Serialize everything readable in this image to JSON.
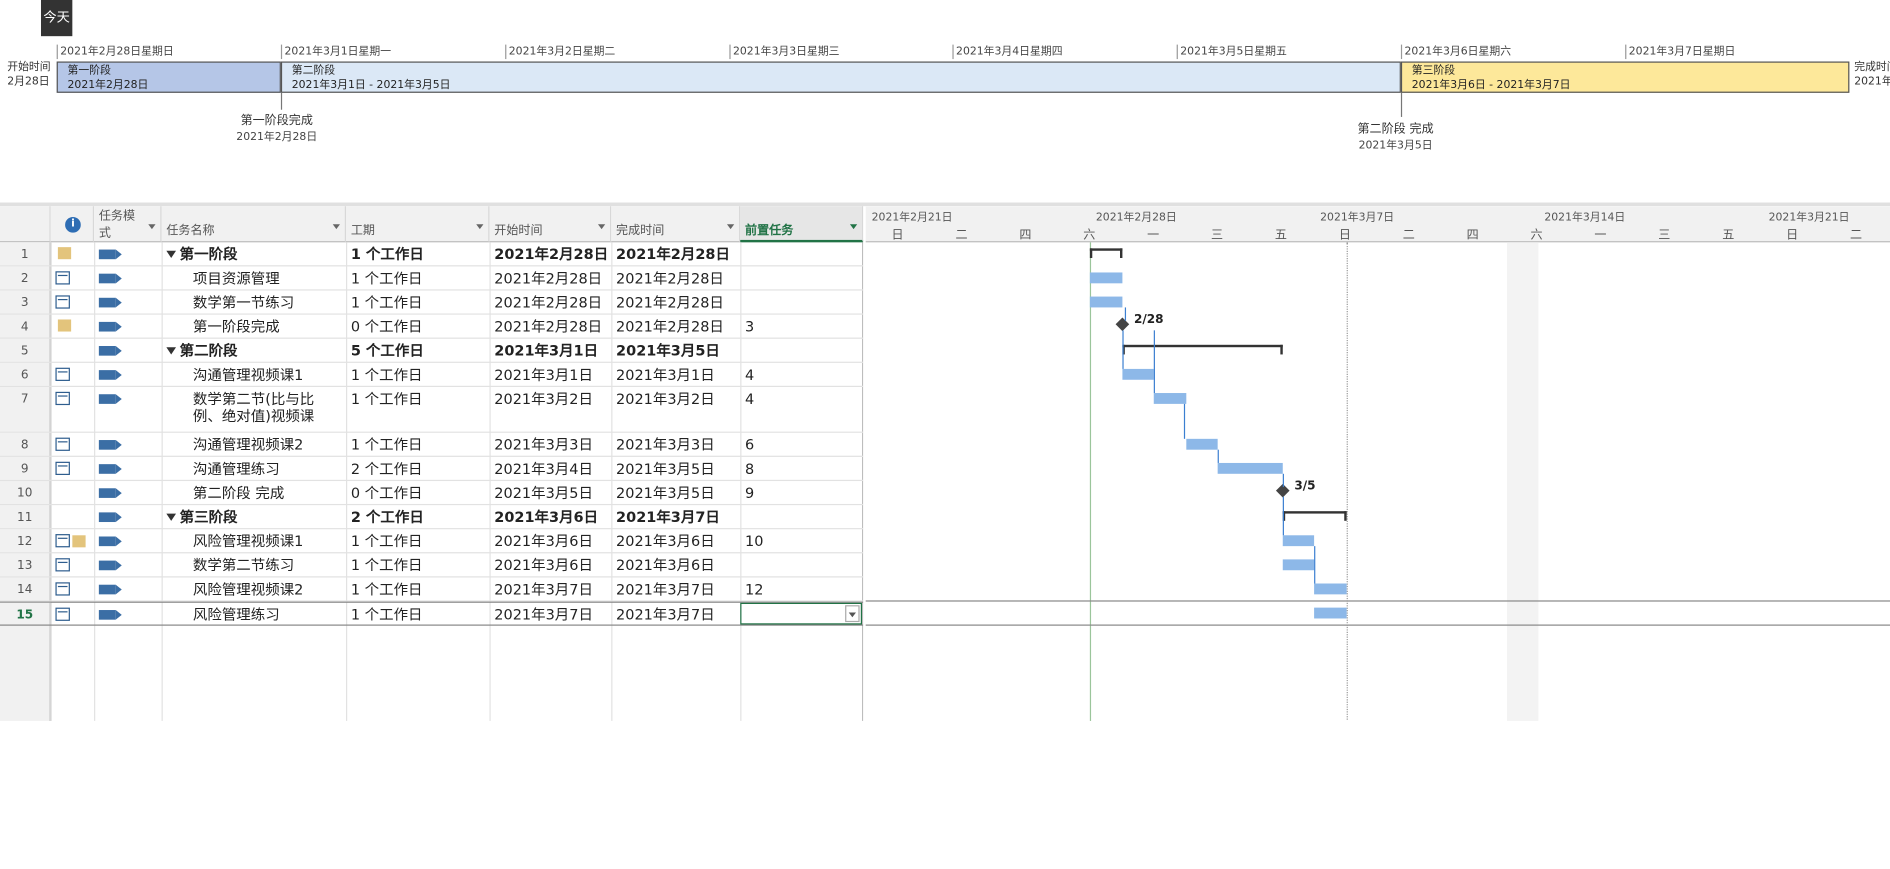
{
  "today_label": "今天",
  "timeline": {
    "start_label": "开始时间",
    "start_date_partial": "2月28日",
    "finish_label": "完成时间",
    "finish_date_partial": "2021年",
    "dates": [
      "2021年2月28日星期日",
      "2021年3月1日星期一",
      "2021年3月2日星期二",
      "2021年3月3日星期三",
      "2021年3月4日星期四",
      "2021年3月5日星期五",
      "2021年3月6日星期六",
      "2021年3月7日星期日"
    ],
    "bands": [
      {
        "name": "第一阶段",
        "range": "2021年2月28日",
        "color": "#b5c6e7"
      },
      {
        "name": "第二阶段",
        "range": "2021年3月1日 - 2021年3月5日",
        "color": "#dbe8f6"
      },
      {
        "name": "第三阶段",
        "range": "2021年3月6日 - 2021年3月7日",
        "color": "#fde89a"
      }
    ],
    "milestones": [
      {
        "name": "第一阶段完成",
        "date": "2021年2月28日"
      },
      {
        "name": "第二阶段 完成",
        "date": "2021年3月5日"
      }
    ]
  },
  "columns": {
    "info": "i",
    "mode": "任务模式",
    "name": "任务名称",
    "duration": "工期",
    "start": "开始时间",
    "finish": "完成时间",
    "pred": "前置任务"
  },
  "tasks": [
    {
      "id": "1",
      "name": "第一阶段",
      "duration": "1 个工作日",
      "start": "2021年2月28日",
      "finish": "2021年2月28日",
      "pred": "",
      "summary": true,
      "indicators": "note"
    },
    {
      "id": "2",
      "name": "项目资源管理",
      "duration": "1 个工作日",
      "start": "2021年2月28日",
      "finish": "2021年2月28日",
      "pred": "",
      "summary": false,
      "indicators": "cal"
    },
    {
      "id": "3",
      "name": "数学第一节练习",
      "duration": "1 个工作日",
      "start": "2021年2月28日",
      "finish": "2021年2月28日",
      "pred": "",
      "summary": false,
      "indicators": "cal"
    },
    {
      "id": "4",
      "name": "第一阶段完成",
      "duration": "0 个工作日",
      "start": "2021年2月28日",
      "finish": "2021年2月28日",
      "pred": "3",
      "summary": false,
      "indicators": "note"
    },
    {
      "id": "5",
      "name": "第二阶段",
      "duration": "5 个工作日",
      "start": "2021年3月1日",
      "finish": "2021年3月5日",
      "pred": "",
      "summary": true,
      "indicators": ""
    },
    {
      "id": "6",
      "name": "沟通管理视频课1",
      "duration": "1 个工作日",
      "start": "2021年3月1日",
      "finish": "2021年3月1日",
      "pred": "4",
      "summary": false,
      "indicators": "cal"
    },
    {
      "id": "7",
      "name": "数学第二节(比与比",
      "name2": "例、绝对值)视频课",
      "duration": "1 个工作日",
      "start": "2021年3月2日",
      "finish": "2021年3月2日",
      "pred": "4",
      "summary": false,
      "indicators": "cal"
    },
    {
      "id": "8",
      "name": "沟通管理视频课2",
      "duration": "1 个工作日",
      "start": "2021年3月3日",
      "finish": "2021年3月3日",
      "pred": "6",
      "summary": false,
      "indicators": "cal"
    },
    {
      "id": "9",
      "name": "沟通管理练习",
      "duration": "2 个工作日",
      "start": "2021年3月4日",
      "finish": "2021年3月5日",
      "pred": "8",
      "summary": false,
      "indicators": "cal"
    },
    {
      "id": "10",
      "name": "第二阶段 完成",
      "duration": "0 个工作日",
      "start": "2021年3月5日",
      "finish": "2021年3月5日",
      "pred": "9",
      "summary": false,
      "indicators": ""
    },
    {
      "id": "11",
      "name": "第三阶段",
      "duration": "2 个工作日",
      "start": "2021年3月6日",
      "finish": "2021年3月7日",
      "pred": "",
      "summary": true,
      "indicators": ""
    },
    {
      "id": "12",
      "name": "风险管理视频课1",
      "duration": "1 个工作日",
      "start": "2021年3月6日",
      "finish": "2021年3月6日",
      "pred": "10",
      "summary": false,
      "indicators": "cal-note"
    },
    {
      "id": "13",
      "name": "数学第二节练习",
      "duration": "1 个工作日",
      "start": "2021年3月6日",
      "finish": "2021年3月6日",
      "pred": "",
      "summary": false,
      "indicators": "cal"
    },
    {
      "id": "14",
      "name": "风险管理视频课2",
      "duration": "1 个工作日",
      "start": "2021年3月7日",
      "finish": "2021年3月7日",
      "pred": "12",
      "summary": false,
      "indicators": "cal"
    },
    {
      "id": "15",
      "name": "风险管理练习",
      "duration": "1 个工作日",
      "start": "2021年3月7日",
      "finish": "2021年3月7日",
      "pred": "",
      "summary": false,
      "indicators": "cal"
    }
  ],
  "gantt": {
    "weeks": [
      "2021年2月21日",
      "2021年2月28日",
      "2021年3月7日",
      "2021年3月14日",
      "2021年3月21日"
    ],
    "days": [
      "日",
      "二",
      "四",
      "六",
      "一",
      "三",
      "五",
      "日",
      "二",
      "四",
      "六",
      "一",
      "三",
      "五",
      "日",
      "二"
    ],
    "milestone_labels": [
      "2/28",
      "3/5"
    ]
  }
}
